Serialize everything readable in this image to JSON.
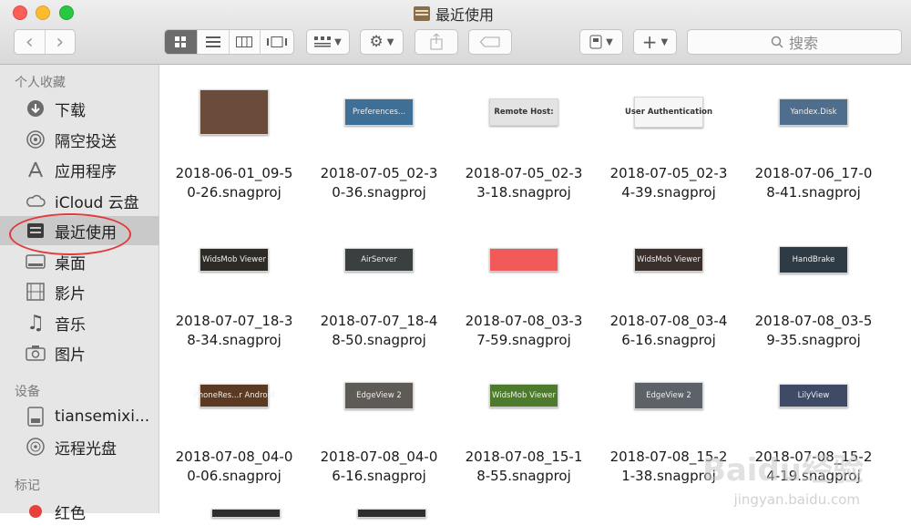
{
  "window": {
    "title": "最近使用"
  },
  "toolbar": {
    "back": "‹",
    "forward": "›",
    "views": [
      "icon-view",
      "list-view",
      "column-view",
      "gallery-view"
    ],
    "group": "group-icon",
    "action": "⚙",
    "share": "share-icon",
    "tags": "tag-icon",
    "arrange": "arrange-icon",
    "add": "+",
    "search_placeholder": "搜索"
  },
  "sidebar": {
    "favorites_header": "个人收藏",
    "favorites": [
      {
        "label": "下载",
        "icon": "download-icon"
      },
      {
        "label": "隔空投送",
        "icon": "airdrop-icon"
      },
      {
        "label": "应用程序",
        "icon": "applications-icon"
      },
      {
        "label": "iCloud 云盘",
        "icon": "icloud-icon"
      },
      {
        "label": "最近使用",
        "icon": "recents-icon",
        "selected": true
      },
      {
        "label": "桌面",
        "icon": "desktop-icon"
      },
      {
        "label": "影片",
        "icon": "movies-icon"
      },
      {
        "label": "音乐",
        "icon": "music-icon"
      },
      {
        "label": "图片",
        "icon": "pictures-icon"
      }
    ],
    "devices_header": "设备",
    "devices": [
      {
        "label": "tiansemixi...",
        "icon": "hard-drive-icon"
      },
      {
        "label": "远程光盘",
        "icon": "optical-disc-icon"
      }
    ],
    "tags_header": "标记",
    "tags": [
      {
        "label": "红色",
        "color": "#e8413c"
      }
    ]
  },
  "files": [
    {
      "line1": "2018-06-01_09-5",
      "line2": "0-26.snagproj",
      "thumb": "",
      "thumb_color": "#6b4c3a"
    },
    {
      "line1": "2018-07-05_02-3",
      "line2": "0-36.snagproj",
      "thumb": "Preferences...",
      "thumb_color": "#3e6f96"
    },
    {
      "line1": "2018-07-05_02-3",
      "line2": "3-18.snagproj",
      "thumb": "Remote Host:",
      "thumb_color": "#e3e3e3"
    },
    {
      "line1": "2018-07-05_02-3",
      "line2": "4-39.snagproj",
      "thumb": "User Authentication",
      "thumb_color": "#f6f6f6"
    },
    {
      "line1": "2018-07-06_17-0",
      "line2": "8-41.snagproj",
      "thumb": "Yandex.Disk",
      "thumb_color": "#4f6d8c"
    },
    {
      "line1": "2018-07-07_18-3",
      "line2": "8-34.snagproj",
      "thumb": "WidsMob Viewer",
      "thumb_color": "#2e2a26"
    },
    {
      "line1": "2018-07-07_18-4",
      "line2": "8-50.snagproj",
      "thumb": "AirServer",
      "thumb_color": "#3a3f40"
    },
    {
      "line1": "2018-07-08_03-3",
      "line2": "7-59.snagproj",
      "thumb": "",
      "thumb_color": "#f25a5a"
    },
    {
      "line1": "2018-07-08_03-4",
      "line2": "6-16.snagproj",
      "thumb": "WidsMob Viewer",
      "thumb_color": "#3a2f2a"
    },
    {
      "line1": "2018-07-08_03-5",
      "line2": "9-35.snagproj",
      "thumb": "HandBrake",
      "thumb_color": "#2e3b44"
    },
    {
      "line1": "2018-07-08_04-0",
      "line2": "0-06.snagproj",
      "thumb": "PhoneRes...r Android",
      "thumb_color": "#5a3a22"
    },
    {
      "line1": "2018-07-08_04-0",
      "line2": "6-16.snagproj",
      "thumb": "EdgeView 2",
      "thumb_color": "#5e5a55"
    },
    {
      "line1": "2018-07-08_15-1",
      "line2": "8-55.snagproj",
      "thumb": "WidsMob Viewer",
      "thumb_color": "#4e7a2e"
    },
    {
      "line1": "2018-07-08_15-2",
      "line2": "1-38.snagproj",
      "thumb": "EdgeView 2",
      "thumb_color": "#5c6268"
    },
    {
      "line1": "2018-07-08_15-2",
      "line2": "4-19.snagproj",
      "thumb": "LilyView",
      "thumb_color": "#3e4a66"
    }
  ],
  "watermark": {
    "brand": "Baidu经验",
    "url": "jingyan.baidu.com"
  }
}
